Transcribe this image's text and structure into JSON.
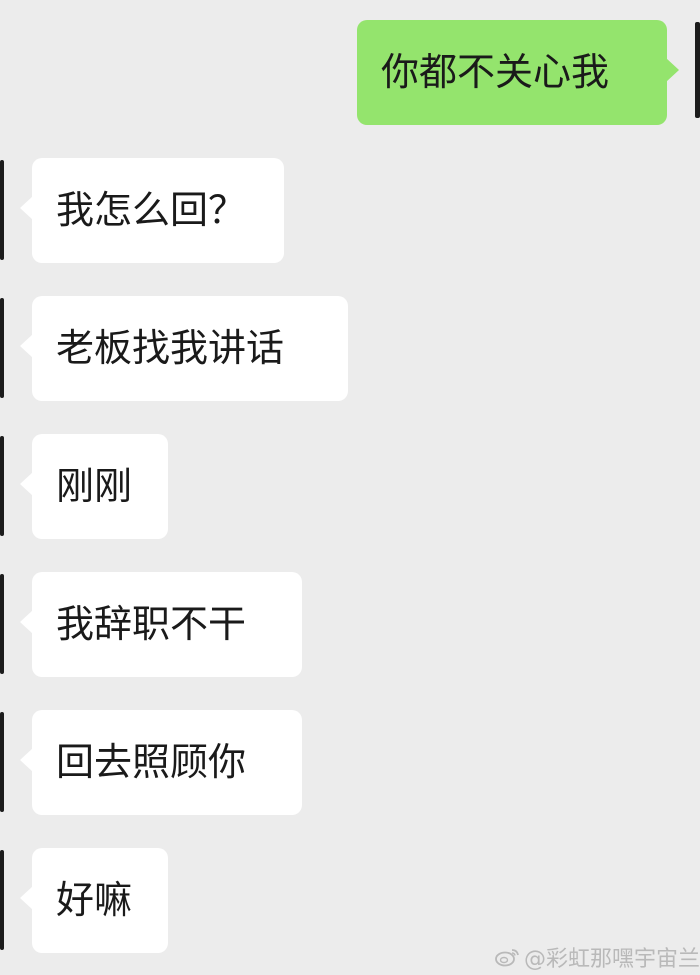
{
  "chat": {
    "sent": [
      {
        "text": "你都不关心我"
      }
    ],
    "received": [
      {
        "text": "我怎么回？"
      },
      {
        "text": "老板找我讲话"
      },
      {
        "text": "刚刚"
      },
      {
        "text": "我辞职不干"
      },
      {
        "text": "回去照顾你"
      },
      {
        "text": "好嘛"
      }
    ]
  },
  "watermark": {
    "text": "@彩虹那嘿宇宙兰"
  },
  "colors": {
    "background": "#ececec",
    "sent_bubble": "#94e46d",
    "received_bubble": "#ffffff",
    "text": "#1a1a1a"
  },
  "icons": {
    "watermark_icon": "weibo-logo-icon"
  }
}
